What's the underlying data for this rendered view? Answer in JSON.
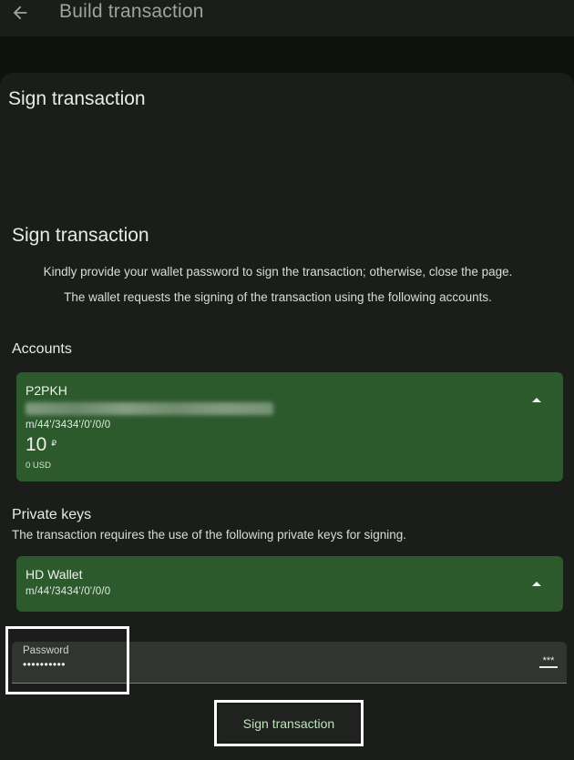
{
  "topbar": {
    "title": "Build transaction",
    "back_icon": "arrow-left-icon"
  },
  "sheet": {
    "title": "Sign transaction"
  },
  "content": {
    "title": "Sign transaction",
    "intro_line_1": "Kindly provide your wallet password to sign the transaction; otherwise, close the page.",
    "intro_line_2": "The wallet requests the signing of the transaction using the following accounts."
  },
  "accounts": {
    "label": "Accounts",
    "items": [
      {
        "type": "P2PKH",
        "path": "m/44'/3434'/0'/0/0",
        "amount": "10",
        "unit": "₽",
        "usd": "0 USD",
        "chevron_icon": "chevron-up-icon"
      }
    ]
  },
  "private_keys": {
    "label": "Private keys",
    "description": "The transaction requires the use of the following private keys for signing.",
    "items": [
      {
        "name": "HD Wallet",
        "path": "m/44'/3434'/0'/0/0",
        "chevron_icon": "chevron-up-icon"
      }
    ]
  },
  "password": {
    "label": "Password",
    "value": "••••••••••",
    "reveal_icon": "reveal-password-icon",
    "reveal_stars": "***"
  },
  "actions": {
    "sign_label": "Sign transaction"
  },
  "colors": {
    "background": "#0f110f",
    "surface": "#1b1d1b",
    "card": "#2c5a2d",
    "button_text": "#bde5b9",
    "highlight": "#ffffff"
  }
}
